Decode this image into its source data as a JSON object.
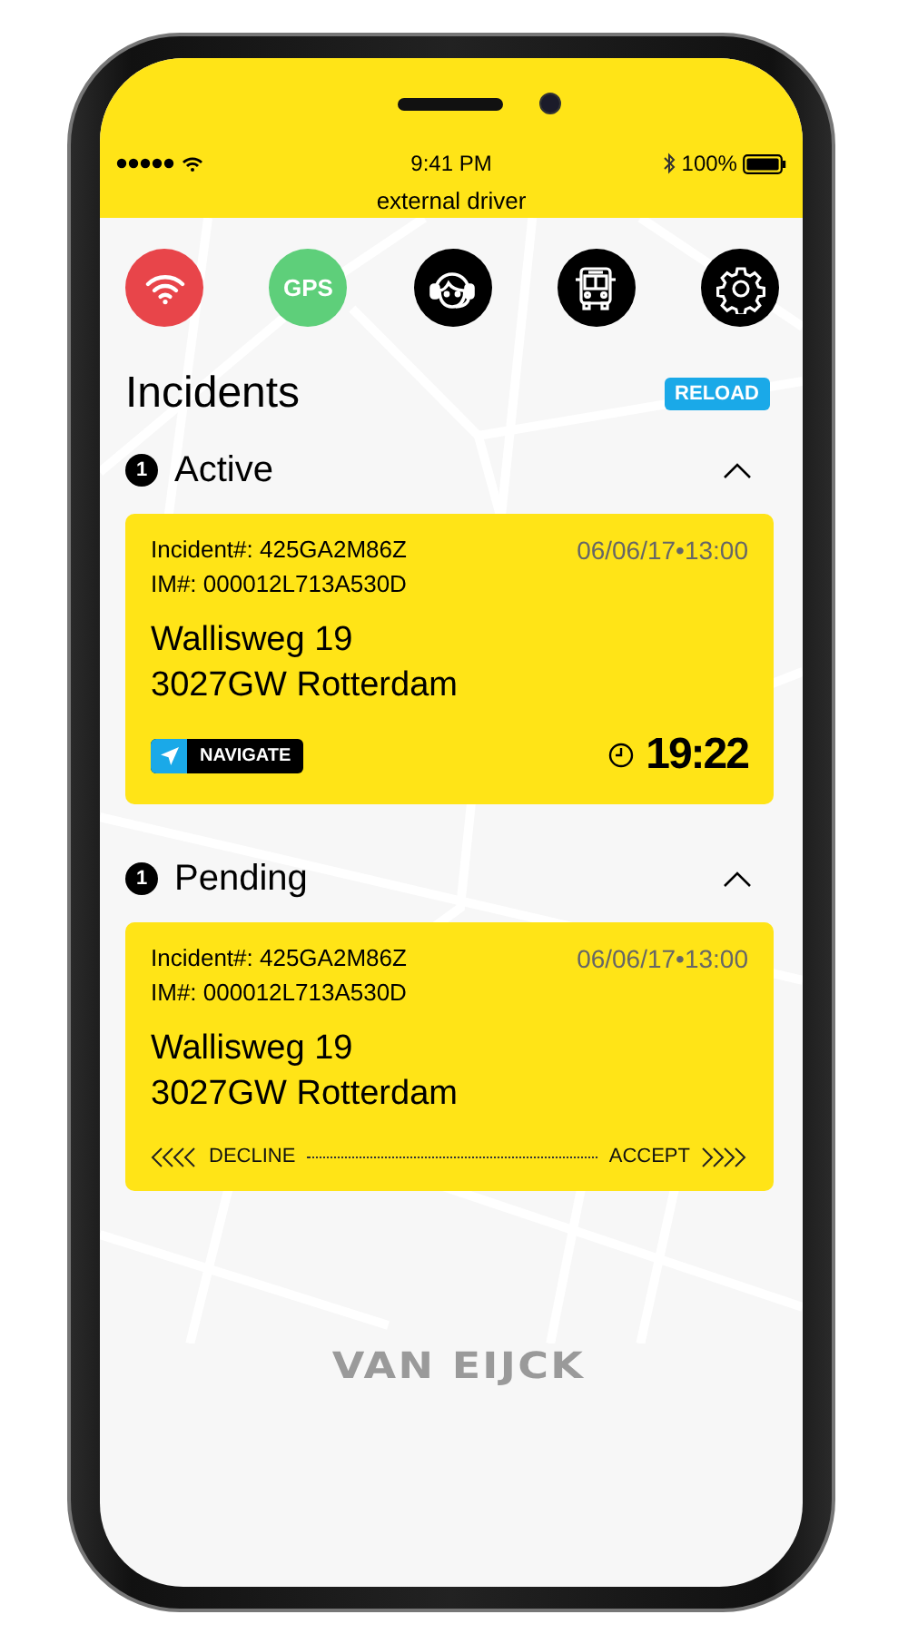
{
  "status_bar": {
    "time": "9:41 PM",
    "battery": "100%"
  },
  "header": {
    "title": "external driver"
  },
  "toolbar": [
    {
      "kind": "wifi",
      "color": "#e8454a"
    },
    {
      "kind": "text",
      "label": "GPS",
      "color": "#5ecf7a"
    },
    {
      "kind": "headset",
      "color": "#000000"
    },
    {
      "kind": "bus",
      "color": "#000000"
    },
    {
      "kind": "gear",
      "color": "#000000"
    }
  ],
  "page_title": "Incidents",
  "reload_button": "RELOAD",
  "sections": [
    {
      "count": "1",
      "title": "Active",
      "expanded": true,
      "cards": [
        {
          "kind": "active",
          "incident": "Incident#: 425GA2M86Z",
          "im": "IM#: 000012L713A530D",
          "datetime": "06/06/17•13:00",
          "street": "Wallisweg 19",
          "city": "3027GW Rotterdam",
          "navigate": "NAVIGATE",
          "eta": "19:22"
        }
      ]
    },
    {
      "count": "1",
      "title": "Pending",
      "expanded": true,
      "cards": [
        {
          "kind": "pending",
          "incident": "Incident#: 425GA2M86Z",
          "im": "IM#: 000012L713A530D",
          "datetime": "06/06/17•13:00",
          "street": "Wallisweg 19",
          "city": "3027GW Rotterdam",
          "decline": "DECLINE",
          "accept": "ACCEPT"
        }
      ]
    }
  ],
  "logo": "VAN EIJCK"
}
